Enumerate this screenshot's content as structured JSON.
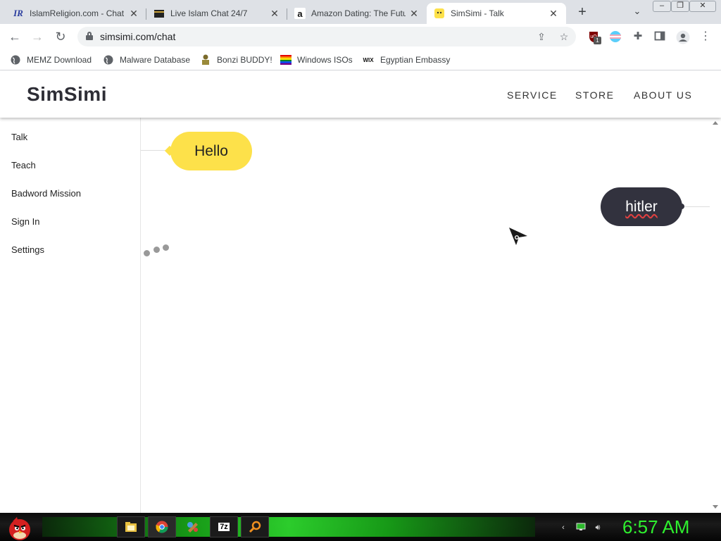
{
  "browser": {
    "tabs": [
      {
        "title": "IslamReligion.com - Chat",
        "favicon": "IR"
      },
      {
        "title": "Live Islam Chat 24/7",
        "favicon": "kaaba"
      },
      {
        "title": "Amazon Dating: The Futu",
        "favicon": "a"
      },
      {
        "title": "SimSimi - Talk",
        "favicon": "simsimi"
      }
    ],
    "new_tab": "+",
    "url": "simsimi.com/chat",
    "bookmarks": [
      {
        "label": "MEMZ Download"
      },
      {
        "label": "Malware Database"
      },
      {
        "label": "Bonzi BUDDY!"
      },
      {
        "label": "Windows ISOs"
      },
      {
        "label": "Egyptian Embassy",
        "icon_text": "WIX"
      }
    ],
    "extension_badge": "1"
  },
  "site": {
    "logo": "SimSimi",
    "nav": [
      "SERVICE",
      "STORE",
      "ABOUT US"
    ],
    "sidebar": [
      "Talk",
      "Teach",
      "Badword Mission",
      "Sign In",
      "Settings"
    ]
  },
  "chat": {
    "messages": [
      {
        "from": "bot",
        "text": "Hello"
      },
      {
        "from": "user",
        "text": "hitler"
      }
    ],
    "bot_color": "#fde14a",
    "user_color": "#32323e"
  },
  "taskbar": {
    "clock": "6:57 AM",
    "clock_color": "#2ef02e"
  }
}
